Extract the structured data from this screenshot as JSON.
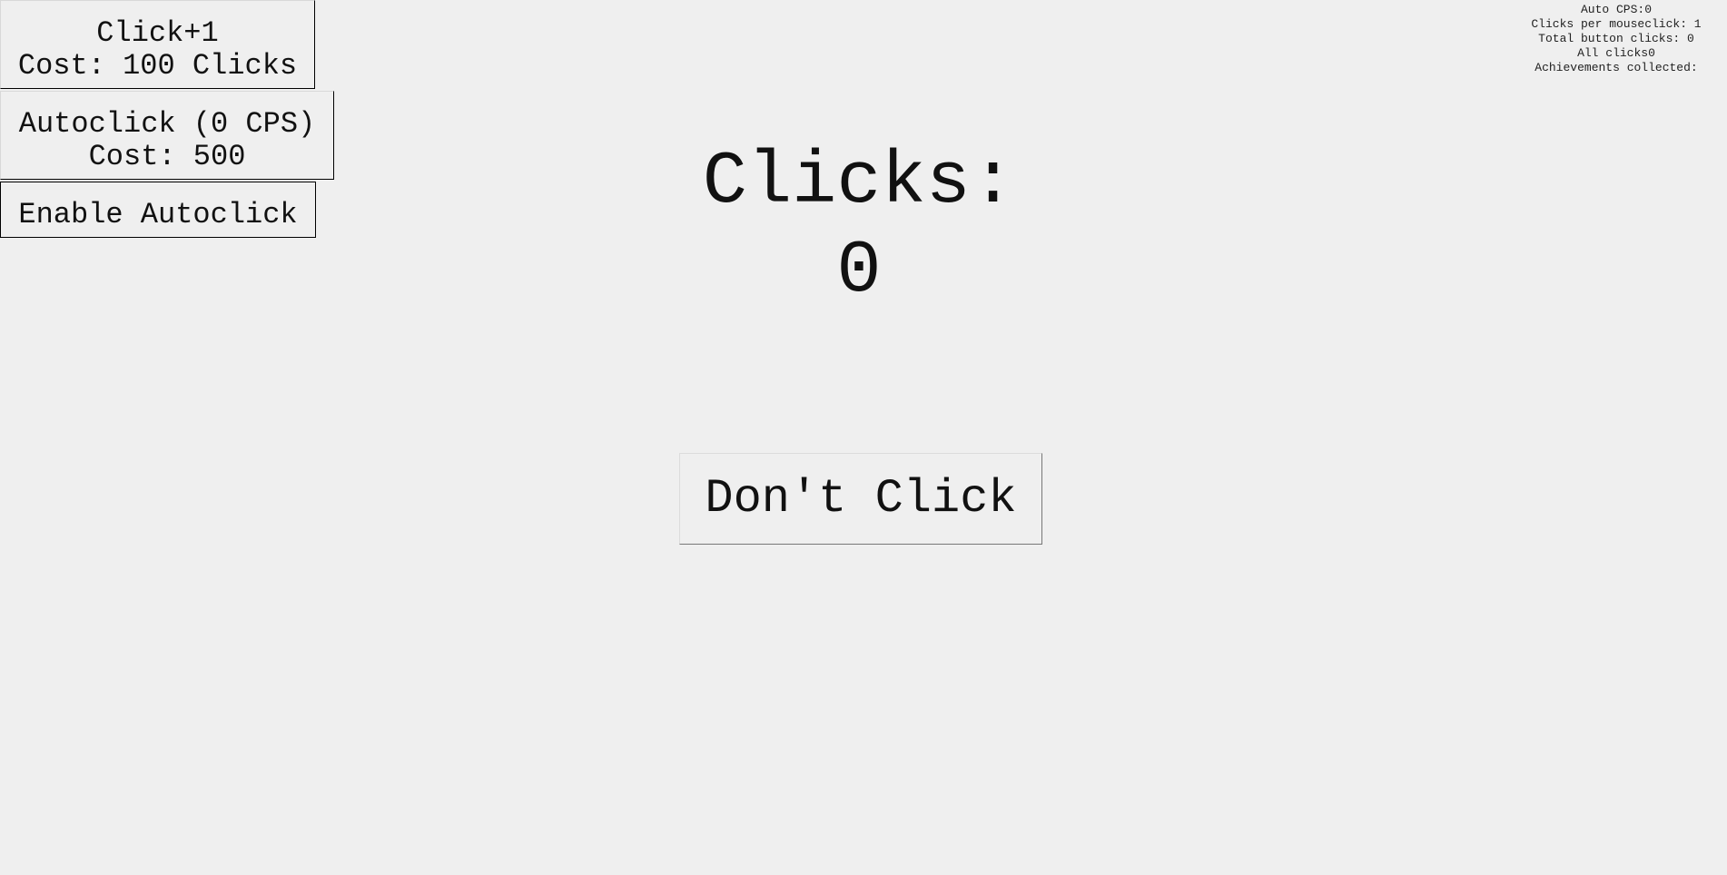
{
  "upgrades": {
    "click_plus": {
      "title": "Click+1",
      "cost": "Cost: 100 Clicks"
    },
    "autoclick": {
      "title": "Autoclick (0 CPS)",
      "cost": "Cost: 500"
    },
    "enable_autoclick": {
      "label": "Enable Autoclick"
    }
  },
  "stats": {
    "auto_cps": "Auto CPS:0",
    "clicks_per_mouseclick": "Clicks per mouseclick: 1",
    "total_button_clicks": "Total button clicks: 0",
    "all_clicks": "All clicks0",
    "achievements": "Achievements collected:"
  },
  "counter": {
    "label": "Clicks:",
    "value": "0"
  },
  "main_button": {
    "label": "Don't Click"
  },
  "colors": {
    "background": "#efefef",
    "text": "#111111",
    "border": "#000000"
  }
}
